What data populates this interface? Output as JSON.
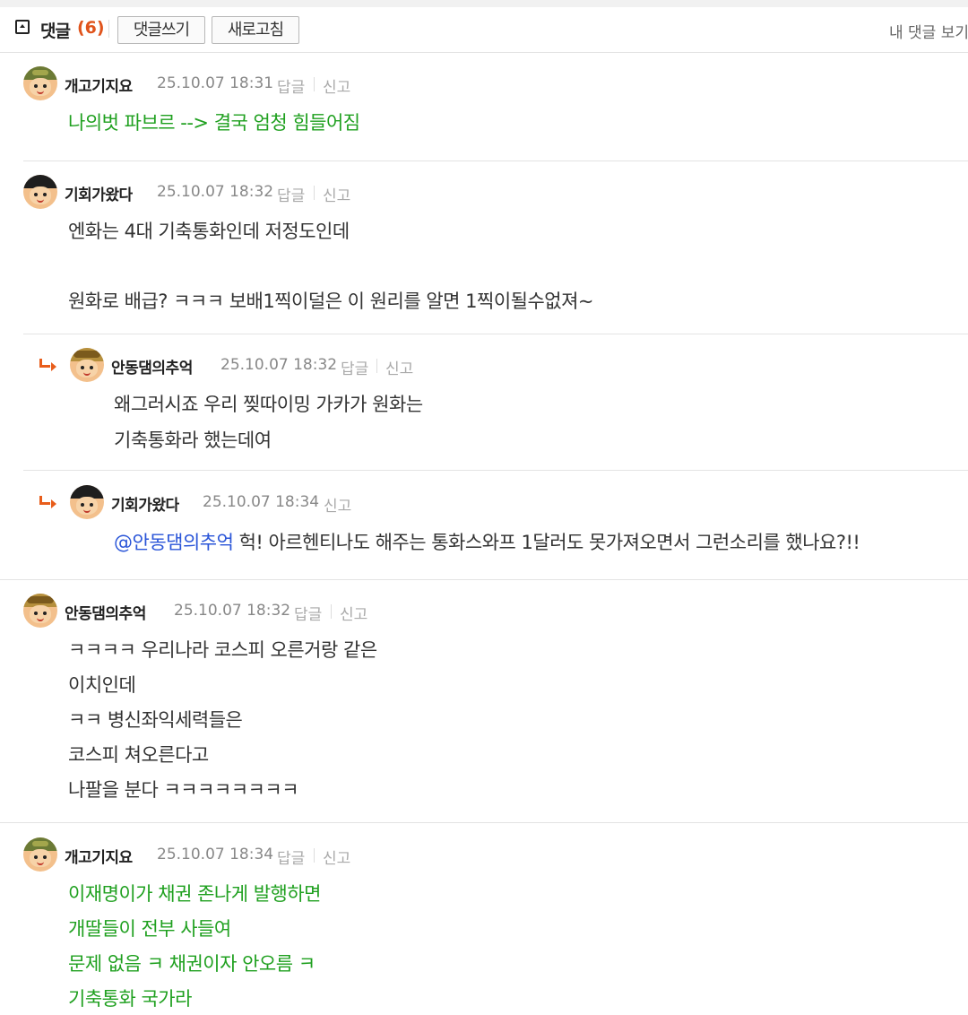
{
  "header": {
    "title": "댓글",
    "count": "(6)",
    "write_button": "댓글쓰기",
    "refresh_button": "새로고침",
    "my_comments": "내 댓글 보기"
  },
  "actions": {
    "reply": "답글",
    "report": "신고"
  },
  "comments": [
    {
      "nick": "개고기지요",
      "date": "25.10.07 18:31",
      "avatar": "army-helmet-icon",
      "lines": [
        "나의벗 파브르 --> 결국 엄청 힘들어짐"
      ],
      "text_color": "#1fa01f"
    },
    {
      "nick": "기회가왔다",
      "date": "25.10.07 18:32",
      "avatar": "black-hair-icon",
      "lines": [
        "엔화는 4대 기축통화인데 저정도인데",
        "원화로 배급? ㅋㅋㅋ 보배1찍이덜은 이 원리를 알면 1찍이될수없져~"
      ],
      "text_color": "#333333"
    },
    {
      "nick": "안동댐의추억",
      "date": "25.10.07 18:32",
      "avatar": "helmet-icon",
      "is_reply": true,
      "lines": [
        "왜그러시죠 우리 찢따이밍 가카가 원화는",
        "기축통화라 했는데여"
      ],
      "text_color": "#333333"
    },
    {
      "nick": "기회가왔다",
      "date": "25.10.07 18:34",
      "avatar": "black-hair-icon",
      "is_reply": true,
      "mention": "@안동댐의추억",
      "lines": [
        " 헉! 아르헨티나도 해주는 통화스와프 1달러도 못가져오면서 그런소리를 했나요?!!"
      ],
      "text_color": "#333333"
    },
    {
      "nick": "안동댐의추억",
      "date": "25.10.07 18:32",
      "avatar": "helmet-icon",
      "lines": [
        "ㅋㅋㅋㅋ 우리나라 코스피 오른거랑 같은",
        "이치인데",
        "ㅋㅋ 병신좌익세력들은",
        "코스피 쳐오른다고",
        "나팔을 분다 ㅋㅋㅋㅋㅋㅋㅋㅋ"
      ],
      "text_color": "#333333"
    },
    {
      "nick": "개고기지요",
      "date": "25.10.07 18:34",
      "avatar": "army-helmet-icon",
      "lines": [
        "이재명이가 채권 존나게 발행하면",
        "개딸들이 전부 사들여",
        "문제 없음 ㅋ 채권이자 안오름 ㅋ",
        "기축통화 국가라"
      ],
      "text_color": "#1fa01f"
    }
  ]
}
